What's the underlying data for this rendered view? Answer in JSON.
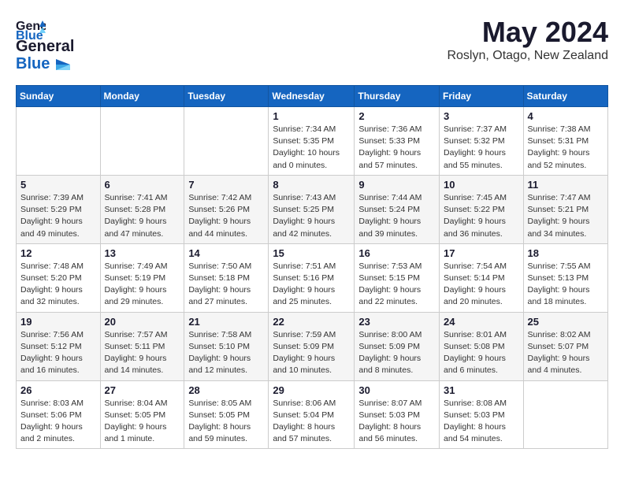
{
  "app": {
    "logo_general": "General",
    "logo_blue": "Blue",
    "month": "May 2024",
    "location": "Roslyn, Otago, New Zealand"
  },
  "calendar": {
    "headers": [
      "Sunday",
      "Monday",
      "Tuesday",
      "Wednesday",
      "Thursday",
      "Friday",
      "Saturday"
    ],
    "weeks": [
      {
        "days": [
          {
            "num": "",
            "info": ""
          },
          {
            "num": "",
            "info": ""
          },
          {
            "num": "",
            "info": ""
          },
          {
            "num": "1",
            "info": "Sunrise: 7:34 AM\nSunset: 5:35 PM\nDaylight: 10 hours\nand 0 minutes."
          },
          {
            "num": "2",
            "info": "Sunrise: 7:36 AM\nSunset: 5:33 PM\nDaylight: 9 hours\nand 57 minutes."
          },
          {
            "num": "3",
            "info": "Sunrise: 7:37 AM\nSunset: 5:32 PM\nDaylight: 9 hours\nand 55 minutes."
          },
          {
            "num": "4",
            "info": "Sunrise: 7:38 AM\nSunset: 5:31 PM\nDaylight: 9 hours\nand 52 minutes."
          }
        ]
      },
      {
        "days": [
          {
            "num": "5",
            "info": "Sunrise: 7:39 AM\nSunset: 5:29 PM\nDaylight: 9 hours\nand 49 minutes."
          },
          {
            "num": "6",
            "info": "Sunrise: 7:41 AM\nSunset: 5:28 PM\nDaylight: 9 hours\nand 47 minutes."
          },
          {
            "num": "7",
            "info": "Sunrise: 7:42 AM\nSunset: 5:26 PM\nDaylight: 9 hours\nand 44 minutes."
          },
          {
            "num": "8",
            "info": "Sunrise: 7:43 AM\nSunset: 5:25 PM\nDaylight: 9 hours\nand 42 minutes."
          },
          {
            "num": "9",
            "info": "Sunrise: 7:44 AM\nSunset: 5:24 PM\nDaylight: 9 hours\nand 39 minutes."
          },
          {
            "num": "10",
            "info": "Sunrise: 7:45 AM\nSunset: 5:22 PM\nDaylight: 9 hours\nand 36 minutes."
          },
          {
            "num": "11",
            "info": "Sunrise: 7:47 AM\nSunset: 5:21 PM\nDaylight: 9 hours\nand 34 minutes."
          }
        ]
      },
      {
        "days": [
          {
            "num": "12",
            "info": "Sunrise: 7:48 AM\nSunset: 5:20 PM\nDaylight: 9 hours\nand 32 minutes."
          },
          {
            "num": "13",
            "info": "Sunrise: 7:49 AM\nSunset: 5:19 PM\nDaylight: 9 hours\nand 29 minutes."
          },
          {
            "num": "14",
            "info": "Sunrise: 7:50 AM\nSunset: 5:18 PM\nDaylight: 9 hours\nand 27 minutes."
          },
          {
            "num": "15",
            "info": "Sunrise: 7:51 AM\nSunset: 5:16 PM\nDaylight: 9 hours\nand 25 minutes."
          },
          {
            "num": "16",
            "info": "Sunrise: 7:53 AM\nSunset: 5:15 PM\nDaylight: 9 hours\nand 22 minutes."
          },
          {
            "num": "17",
            "info": "Sunrise: 7:54 AM\nSunset: 5:14 PM\nDaylight: 9 hours\nand 20 minutes."
          },
          {
            "num": "18",
            "info": "Sunrise: 7:55 AM\nSunset: 5:13 PM\nDaylight: 9 hours\nand 18 minutes."
          }
        ]
      },
      {
        "days": [
          {
            "num": "19",
            "info": "Sunrise: 7:56 AM\nSunset: 5:12 PM\nDaylight: 9 hours\nand 16 minutes."
          },
          {
            "num": "20",
            "info": "Sunrise: 7:57 AM\nSunset: 5:11 PM\nDaylight: 9 hours\nand 14 minutes."
          },
          {
            "num": "21",
            "info": "Sunrise: 7:58 AM\nSunset: 5:10 PM\nDaylight: 9 hours\nand 12 minutes."
          },
          {
            "num": "22",
            "info": "Sunrise: 7:59 AM\nSunset: 5:09 PM\nDaylight: 9 hours\nand 10 minutes."
          },
          {
            "num": "23",
            "info": "Sunrise: 8:00 AM\nSunset: 5:09 PM\nDaylight: 9 hours\nand 8 minutes."
          },
          {
            "num": "24",
            "info": "Sunrise: 8:01 AM\nSunset: 5:08 PM\nDaylight: 9 hours\nand 6 minutes."
          },
          {
            "num": "25",
            "info": "Sunrise: 8:02 AM\nSunset: 5:07 PM\nDaylight: 9 hours\nand 4 minutes."
          }
        ]
      },
      {
        "days": [
          {
            "num": "26",
            "info": "Sunrise: 8:03 AM\nSunset: 5:06 PM\nDaylight: 9 hours\nand 2 minutes."
          },
          {
            "num": "27",
            "info": "Sunrise: 8:04 AM\nSunset: 5:05 PM\nDaylight: 9 hours\nand 1 minute."
          },
          {
            "num": "28",
            "info": "Sunrise: 8:05 AM\nSunset: 5:05 PM\nDaylight: 8 hours\nand 59 minutes."
          },
          {
            "num": "29",
            "info": "Sunrise: 8:06 AM\nSunset: 5:04 PM\nDaylight: 8 hours\nand 57 minutes."
          },
          {
            "num": "30",
            "info": "Sunrise: 8:07 AM\nSunset: 5:03 PM\nDaylight: 8 hours\nand 56 minutes."
          },
          {
            "num": "31",
            "info": "Sunrise: 8:08 AM\nSunset: 5:03 PM\nDaylight: 8 hours\nand 54 minutes."
          },
          {
            "num": "",
            "info": ""
          }
        ]
      }
    ]
  }
}
